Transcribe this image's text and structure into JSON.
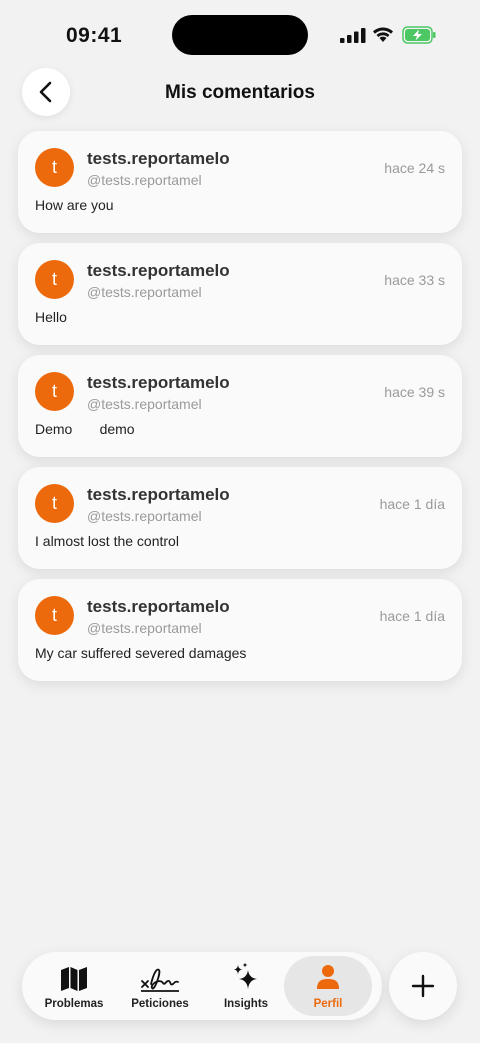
{
  "status_bar": {
    "time": "09:41"
  },
  "header": {
    "title": "Mis comentarios"
  },
  "comments": [
    {
      "avatar_letter": "t",
      "username": "tests.reportamelo",
      "handle": "@tests.reportamel",
      "time_ago": "hace 24 s",
      "text": "How are you"
    },
    {
      "avatar_letter": "t",
      "username": "tests.reportamelo",
      "handle": "@tests.reportamel",
      "time_ago": "hace 33 s",
      "text": "Hello"
    },
    {
      "avatar_letter": "t",
      "username": "tests.reportamelo",
      "handle": "@tests.reportamel",
      "time_ago": "hace 39 s",
      "text": "Demo       demo"
    },
    {
      "avatar_letter": "t",
      "username": "tests.reportamelo",
      "handle": "@tests.reportamel",
      "time_ago": "hace 1 día",
      "text": "I almost lost the control"
    },
    {
      "avatar_letter": "t",
      "username": "tests.reportamelo",
      "handle": "@tests.reportamel",
      "time_ago": "hace 1 día",
      "text": "My car suffered severed damages"
    }
  ],
  "tabs": [
    {
      "label": "Problemas",
      "icon": "map-icon"
    },
    {
      "label": "Peticiones",
      "icon": "signature-icon"
    },
    {
      "label": "Insights",
      "icon": "sparkles-icon"
    },
    {
      "label": "Perfil",
      "icon": "person-icon",
      "active": true
    }
  ],
  "colors": {
    "accent": "#ec6a0c",
    "background": "#f2f2f2",
    "card": "#fafafa"
  }
}
